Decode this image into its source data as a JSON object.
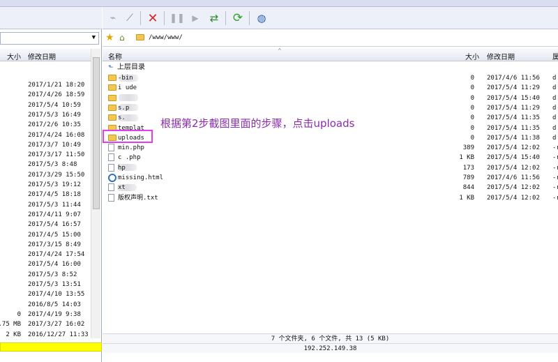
{
  "left_pane": {
    "col_size": "大小",
    "col_date": "修改日期",
    "rows": [
      {
        "size": "",
        "date": "2017/1/21 18:20"
      },
      {
        "size": "",
        "date": "2017/4/26 18:59"
      },
      {
        "size": "",
        "date": "2017/5/4 10:59"
      },
      {
        "size": "",
        "date": "2017/5/3 16:49"
      },
      {
        "size": "",
        "date": "2017/2/6 10:35"
      },
      {
        "size": "",
        "date": "2017/4/24 16:08"
      },
      {
        "size": "",
        "date": "2017/3/7 10:49"
      },
      {
        "size": "",
        "date": "2017/3/17 11:50"
      },
      {
        "size": "",
        "date": "2017/5/3 8:48"
      },
      {
        "size": "",
        "date": "2017/3/29 15:50"
      },
      {
        "size": "",
        "date": "2017/5/3 19:12"
      },
      {
        "size": "",
        "date": "2017/4/5 18:18"
      },
      {
        "size": "",
        "date": "2017/5/3 11:44"
      },
      {
        "size": "",
        "date": "2017/4/11 9:07"
      },
      {
        "size": "",
        "date": "2017/5/4 16:57"
      },
      {
        "size": "",
        "date": "2017/4/5 15:00"
      },
      {
        "size": "",
        "date": "2017/3/15 8:49"
      },
      {
        "size": "",
        "date": "2017/4/24 17:54"
      },
      {
        "size": "",
        "date": "2017/5/4 16:00"
      },
      {
        "size": "",
        "date": "2017/5/3 8:52"
      },
      {
        "size": "",
        "date": "2017/5/3 13:51"
      },
      {
        "size": "",
        "date": "2017/4/10 13:55"
      },
      {
        "size": "",
        "date": "2016/8/5 14:03"
      },
      {
        "size": "0",
        "date": "2017/4/19 9:38"
      },
      {
        "size": ".75 MB",
        "date": "2017/3/27 16:02"
      },
      {
        "size": "2 KB",
        "date": "2016/12/27 11:33"
      }
    ]
  },
  "remote": {
    "path": "/www/www/",
    "col_name": "名称",
    "col_size": "大小",
    "col_date": "修改日期",
    "col_attr": "属",
    "parent_label": "上层目录",
    "items": [
      {
        "name": "-bin",
        "size": "0",
        "date": "2017/4/6 11:56",
        "attr": "d",
        "type": "folder"
      },
      {
        "name": "i  ude",
        "size": "0",
        "date": "2017/5/4 11:29",
        "attr": "d",
        "type": "folder"
      },
      {
        "name": "",
        "size": "0",
        "date": "2017/5/4 15:40",
        "attr": "d",
        "type": "folder"
      },
      {
        "name": "s.p",
        "size": "0",
        "date": "2017/5/4 11:29",
        "attr": "d",
        "type": "folder"
      },
      {
        "name": "s.",
        "size": "0",
        "date": "2017/5/4 11:35",
        "attr": "d",
        "type": "folder"
      },
      {
        "name": "templat",
        "size": "0",
        "date": "2017/5/4 11:35",
        "attr": "d",
        "type": "folder"
      },
      {
        "name": "uploads",
        "size": "0",
        "date": "2017/5/4 11:38",
        "attr": "d",
        "type": "folder"
      },
      {
        "name": "min.php",
        "size": "389",
        "date": "2017/5/4 12:02",
        "attr": "-r",
        "type": "file"
      },
      {
        "name": "c    .php",
        "size": "1 KB",
        "date": "2017/5/4 15:40",
        "attr": "-r",
        "type": "file"
      },
      {
        "name": "hp",
        "size": "173",
        "date": "2017/5/4 12:02",
        "attr": "-r",
        "type": "file"
      },
      {
        "name": "missing.html",
        "size": "789",
        "date": "2017/4/6 11:56",
        "attr": "-r",
        "type": "web"
      },
      {
        "name": "  xt",
        "size": "844",
        "date": "2017/5/4 12:02",
        "attr": "-r",
        "type": "file"
      },
      {
        "name": "版权声明.txt",
        "size": "1 KB",
        "date": "2017/5/4 12:02",
        "attr": "-r",
        "type": "file"
      }
    ],
    "status_summary": "7 个文件夹, 6 个文件, 共 13 (5 KB)",
    "status_ip": "192.252.149.38"
  },
  "annotation": "根据第2步截图里面的步骤，点击uploads",
  "colors": {
    "annotation": "#8b2bb0",
    "highlight": "#e53cf0",
    "progress": "#ffff00"
  }
}
